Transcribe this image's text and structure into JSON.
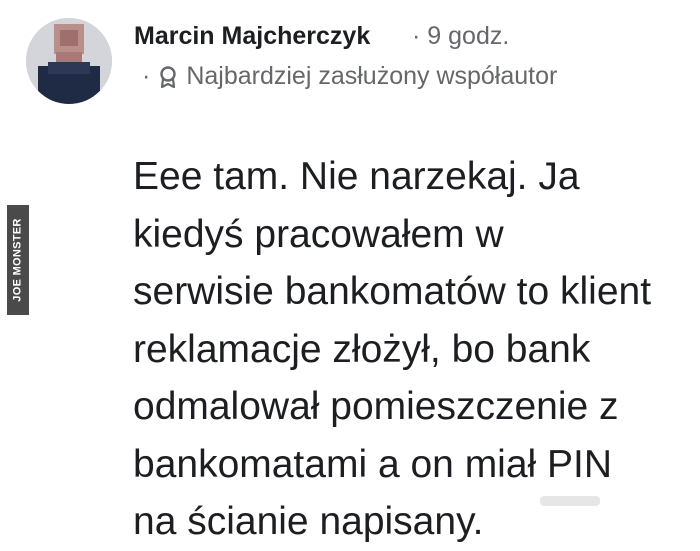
{
  "comment": {
    "author": "Marcin Majcherczyk",
    "separator": "·",
    "time": "9 godz.",
    "badge": {
      "dot": "·",
      "icon": "award-badge-icon",
      "label": "Najbardziej zasłużony współautor"
    },
    "lines": [
      "Eee tam.  Nie narzekaj. Ja",
      "kiedyś pracowałem w",
      "serwisie bankomatów to klient",
      "reklamacje złożył, bo bank",
      "odmalował pomieszczenie z",
      "bankomatami a on miał PIN",
      "na ścianie napisany."
    ]
  },
  "watermark": "JOE MONSTER",
  "colors": {
    "text": "#1c1e21",
    "secondary": "#65676b",
    "background": "#ffffff",
    "watermark_bg": "#4a4a4a"
  }
}
